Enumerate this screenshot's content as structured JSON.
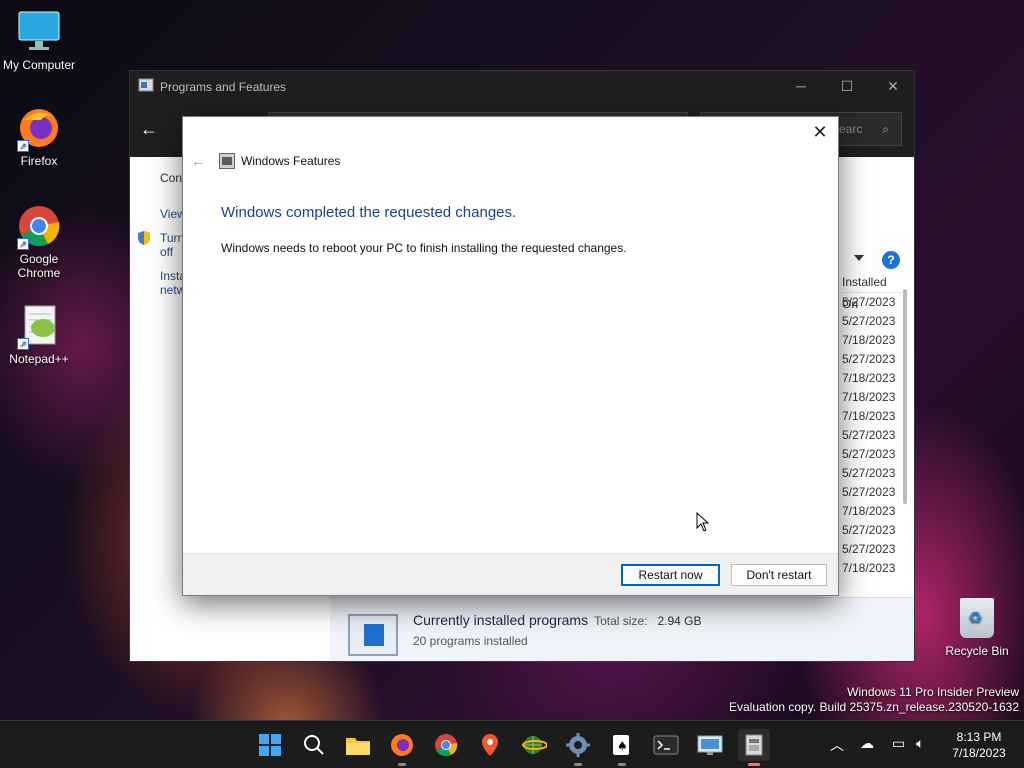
{
  "desktop": {
    "icons": [
      {
        "label": "My Computer"
      },
      {
        "label": "Firefox"
      },
      {
        "label": "Google Chrome"
      },
      {
        "label": "Notepad++"
      },
      {
        "label": "Recycle Bin"
      }
    ],
    "watermark": {
      "line1": "Windows 11 Pro Insider Preview",
      "line2": "Evaluation copy. Build 25375.zn_release.230520-1632"
    }
  },
  "programs_window": {
    "title": "Programs and Features",
    "search_placeholder": "Searc",
    "sidebar": {
      "control_panel": "Cont",
      "view": "View",
      "turn_line1": "Turn",
      "turn_line2": "off",
      "install_line1": "Insta",
      "install_line2": "netw"
    },
    "column_header": "Installed On",
    "installed_dates": [
      "5/27/2023",
      "5/27/2023",
      "7/18/2023",
      "5/27/2023",
      "7/18/2023",
      "7/18/2023",
      "7/18/2023",
      "5/27/2023",
      "5/27/2023",
      "5/27/2023",
      "5/27/2023",
      "7/18/2023",
      "5/27/2023",
      "5/27/2023",
      "7/18/2023"
    ],
    "summary": {
      "title": "Currently installed programs",
      "total_label": "Total size:",
      "total_value": "2.94 GB",
      "count": "20 programs installed"
    }
  },
  "dialog": {
    "header": "Windows Features",
    "heading": "Windows completed the requested changes.",
    "message": "Windows needs to reboot your PC to finish installing the requested changes.",
    "restart_button": "Restart now",
    "dont_restart_button": "Don't restart"
  },
  "taskbar": {
    "time": "8:13 PM",
    "date": "7/18/2023"
  }
}
